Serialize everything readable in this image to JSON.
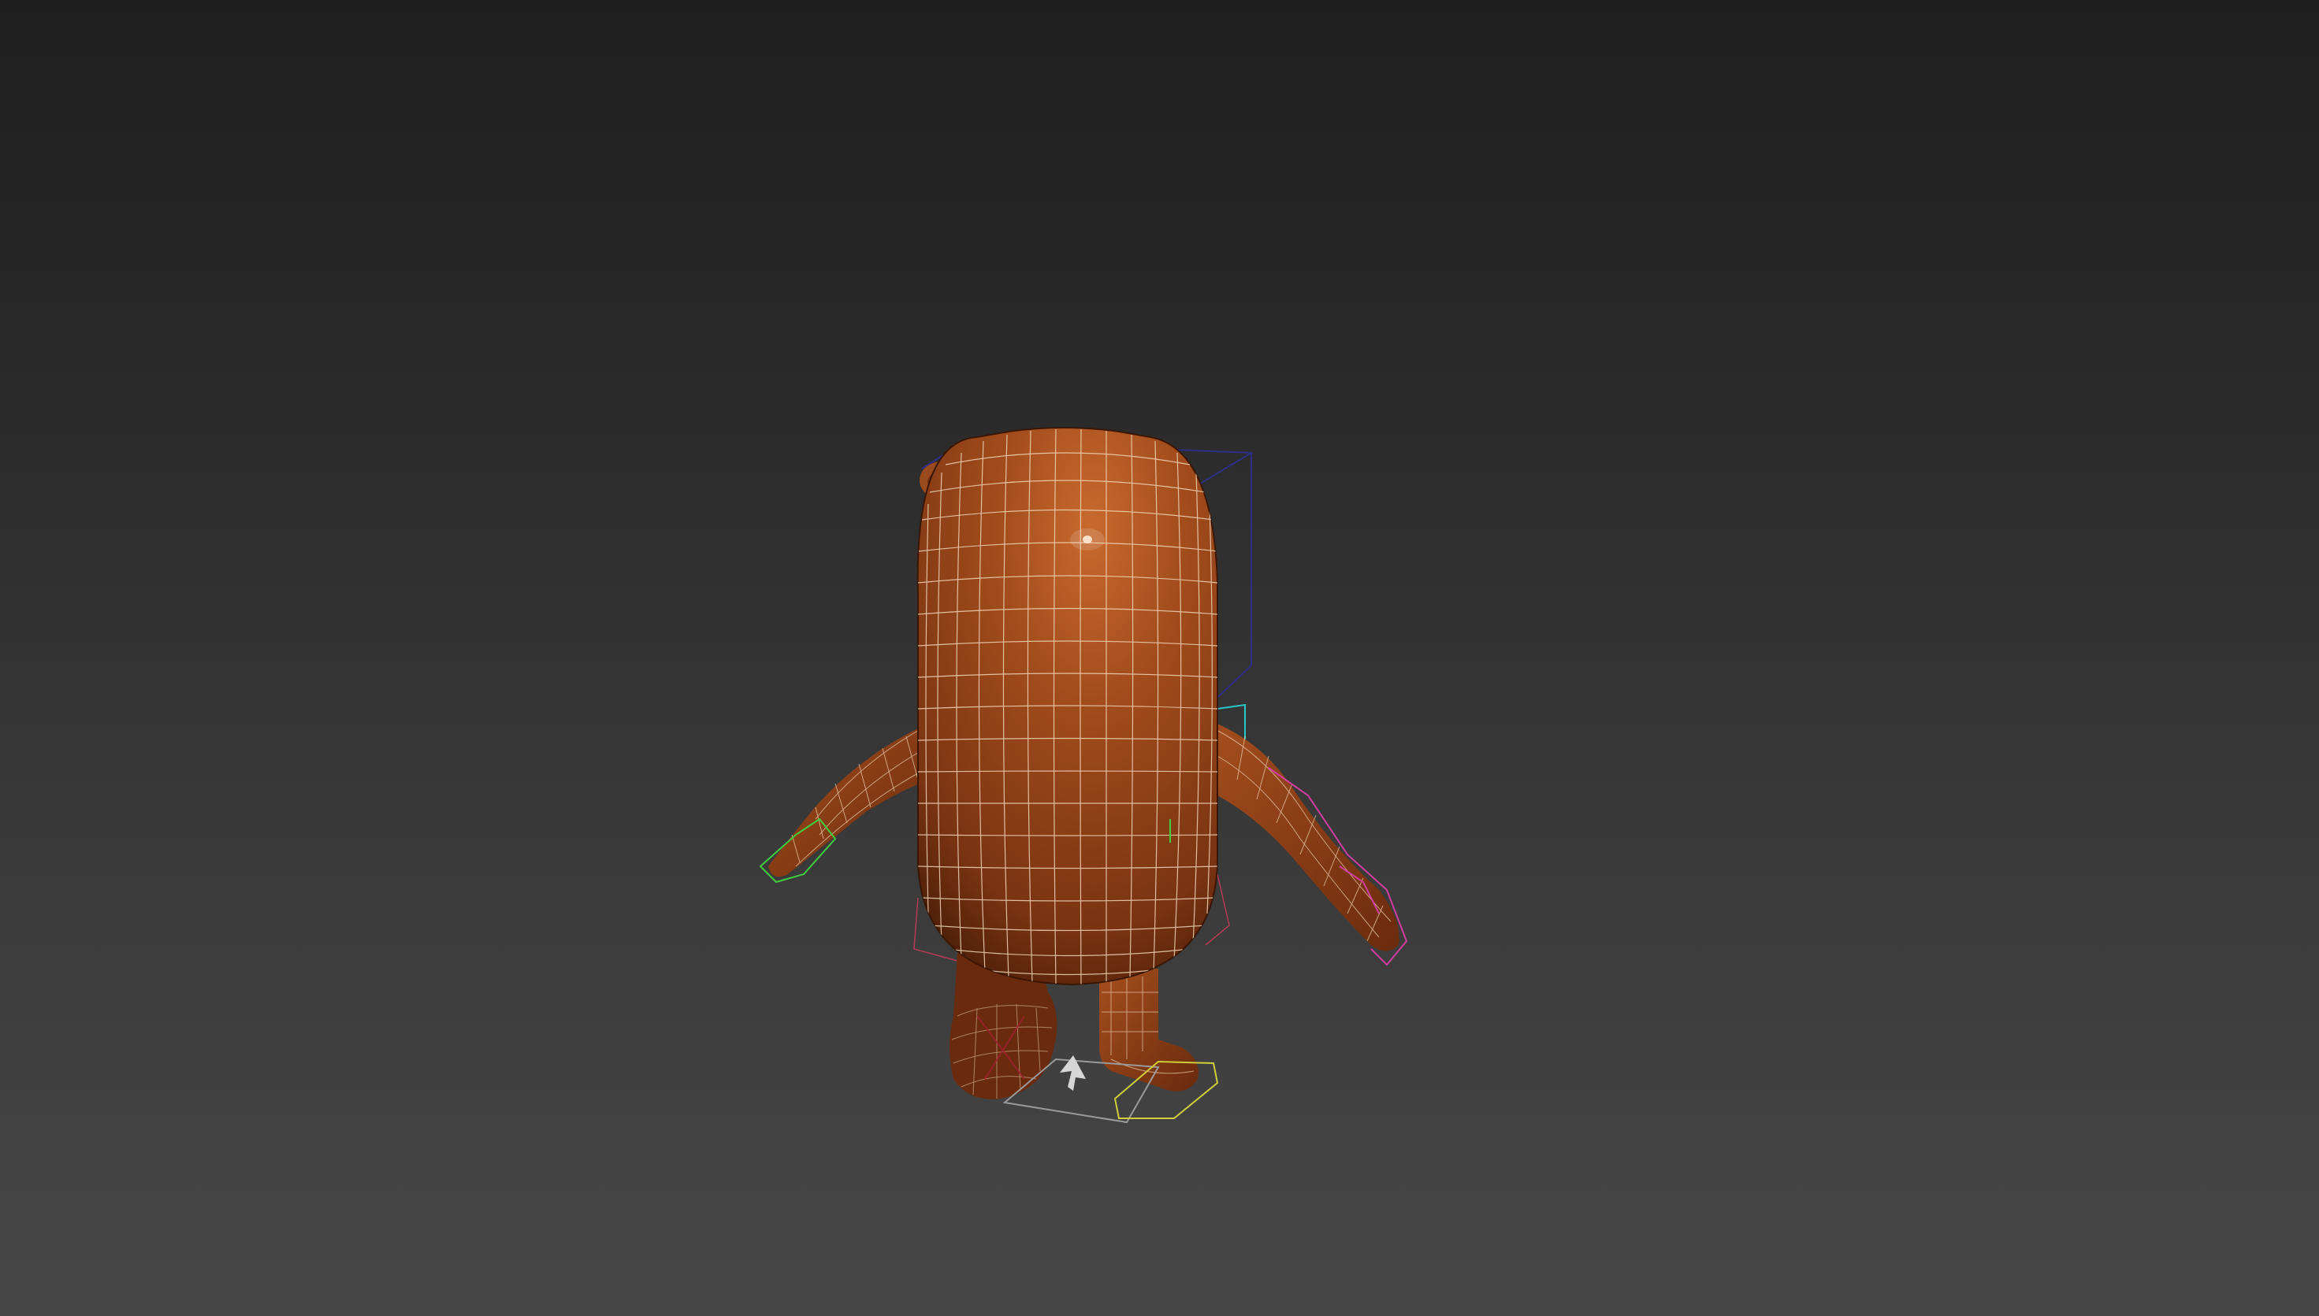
{
  "viewport": {
    "background_top": "#1f1f1f",
    "background_bottom": "#474747"
  },
  "model": {
    "body_color": "#8a3d16",
    "body_highlight": "#c4652a",
    "wire_color": "#e8c9a8",
    "bones": [
      {
        "color": "#2a2a8a"
      },
      {
        "color": "#29c7c7"
      },
      {
        "color": "#3fcf3f"
      },
      {
        "color": "#d23da0"
      },
      {
        "color": "#cfcf3a"
      },
      {
        "color": "#c23a5a"
      }
    ]
  },
  "icons": {
    "gizmo": "up-arrow-icon"
  }
}
